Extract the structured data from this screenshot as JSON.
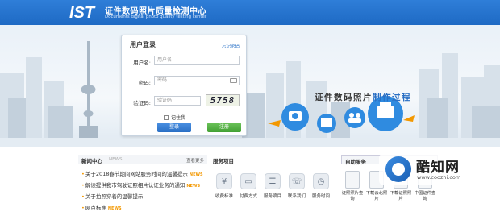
{
  "header": {
    "logo_text": "IST",
    "title": "证件数码照片质量检测中心",
    "subtitle": "Documents digital photo quality testing center"
  },
  "banner": {
    "slogan_main": "证件数码照片",
    "slogan_accent": "制作过程"
  },
  "login": {
    "title": "用户登录",
    "forgot_link": "忘记密码",
    "username_label": "用户名:",
    "username_placeholder": "用户名",
    "password_label": "密码:",
    "password_placeholder": "密码",
    "captcha_label": "验证码:",
    "captcha_placeholder": "验证码",
    "captcha_code": "5758",
    "remember_label": "记住我",
    "login_button": "登录",
    "register_button": "注册"
  },
  "news": {
    "title": "新闻中心",
    "title_en": "NEWS",
    "more": "查看更多",
    "items": [
      {
        "text": "关于2018春节期间网站服务时间的温馨提示",
        "tag": "NEWS"
      },
      {
        "text": "解读提供我市驾驶证照相片认证业务的通知",
        "tag": "NEWS"
      },
      {
        "text": "关于拍照穿着的温馨提示",
        "tag": ""
      },
      {
        "text": "网点标准",
        "tag": "NEWS"
      }
    ]
  },
  "services": {
    "title": "服务项目",
    "items": [
      {
        "label": "收费标准",
        "icon": "price-icon"
      },
      {
        "label": "付费方式",
        "icon": "payment-icon"
      },
      {
        "label": "服务项目",
        "icon": "list-icon"
      },
      {
        "label": "联系我们",
        "icon": "phone-icon"
      },
      {
        "label": "服务时间",
        "icon": "clock-icon"
      }
    ]
  },
  "selfhelp": {
    "title": "自助服务",
    "items": [
      {
        "label": "证照照片查询"
      },
      {
        "label": "下载云北照片"
      },
      {
        "label": "下载证照照片"
      },
      {
        "label": "中国证件查询"
      }
    ]
  },
  "watermark": {
    "brand": "酷知网",
    "url": "www.coozhi.com"
  },
  "colors": {
    "header_blue": "#1e6ac4",
    "accent_orange": "#f39800",
    "register_green": "#42a033"
  }
}
